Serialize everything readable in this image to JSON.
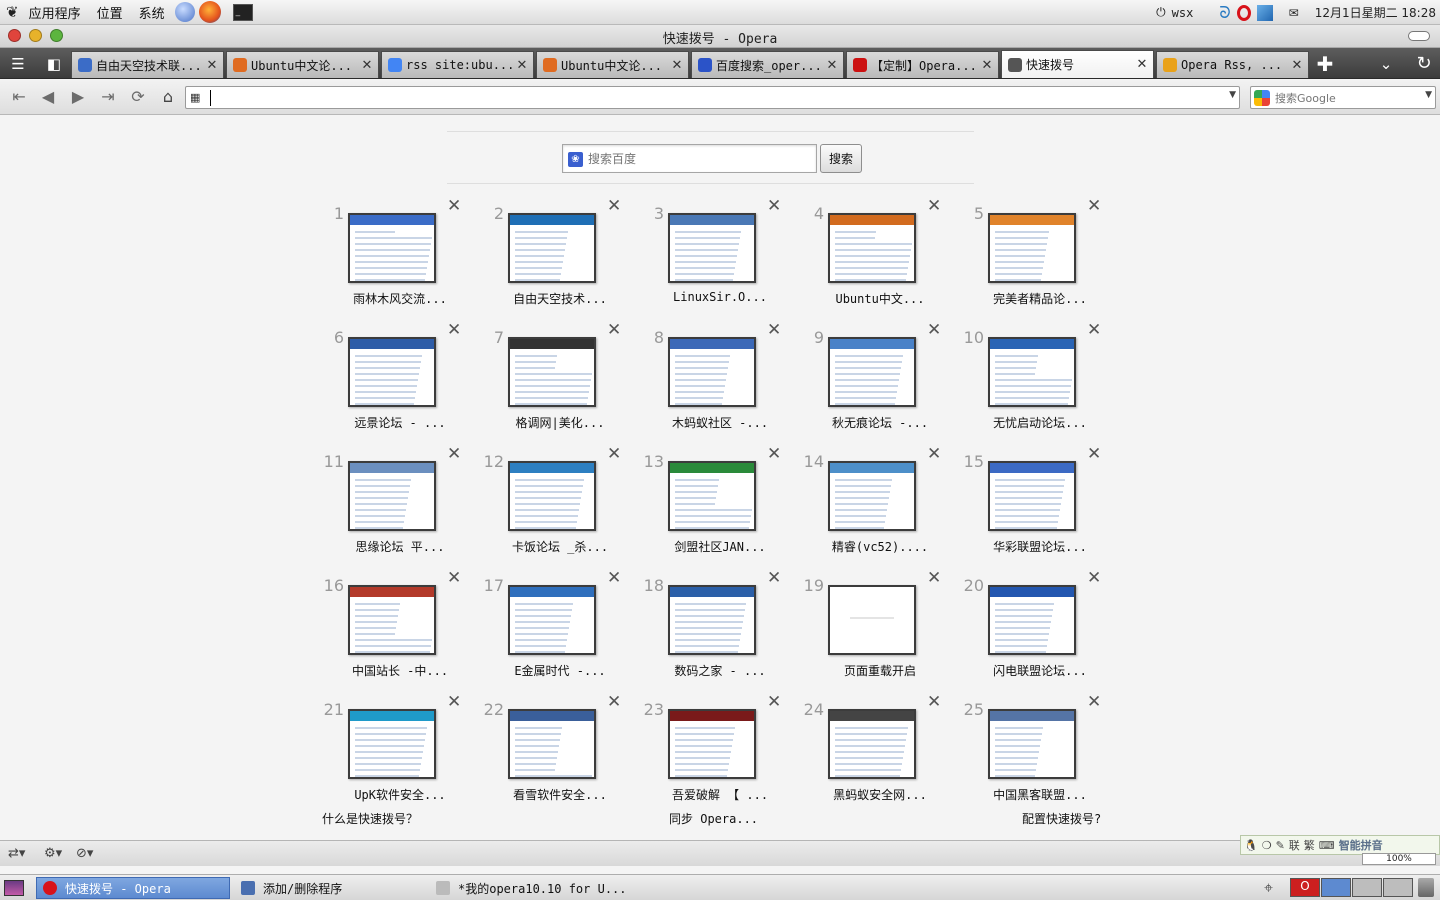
{
  "top_panel": {
    "menus": [
      "应用程序",
      "位置",
      "系统"
    ],
    "user": "wsx",
    "clock": "12月1日星期二 18:28"
  },
  "window": {
    "title": "快速拨号 - Opera"
  },
  "tabs": [
    {
      "label": "自由天空技术联...",
      "icon_color": "#3b6cc7"
    },
    {
      "label": "Ubuntu中文论...",
      "icon_color": "#e06b21"
    },
    {
      "label": "rss site:ubu...",
      "icon_color": "#4285f4"
    },
    {
      "label": "Ubuntu中文论...",
      "icon_color": "#e06b21"
    },
    {
      "label": "百度搜索_oper...",
      "icon_color": "#2b53c8"
    },
    {
      "label": "【定制】Opera...",
      "icon_color": "#cc1111"
    },
    {
      "label": "快速拨号",
      "icon_color": "#555555",
      "active": true
    },
    {
      "label": "Opera Rss, ...",
      "icon_color": "#e9a21a"
    }
  ],
  "navbar": {
    "address_value": "",
    "search_placeholder": "搜索Google"
  },
  "speed_dial": {
    "search_placeholder": "搜索百度",
    "search_button": "搜索",
    "cells": [
      {
        "n": "1",
        "caption": "雨林木风交流..."
      },
      {
        "n": "2",
        "caption": "自由天空技术..."
      },
      {
        "n": "3",
        "caption": "LinuxSir.O..."
      },
      {
        "n": "4",
        "caption": "Ubuntu中文..."
      },
      {
        "n": "5",
        "caption": "完美者精品论..."
      },
      {
        "n": "6",
        "caption": "远景论坛 - ..."
      },
      {
        "n": "7",
        "caption": "格调网|美化..."
      },
      {
        "n": "8",
        "caption": "木蚂蚁社区 -..."
      },
      {
        "n": "9",
        "caption": "秋无痕论坛 -..."
      },
      {
        "n": "10",
        "caption": "无忧启动论坛..."
      },
      {
        "n": "11",
        "caption": "思缘论坛 平..."
      },
      {
        "n": "12",
        "caption": "卡饭论坛 _杀..."
      },
      {
        "n": "13",
        "caption": "剑盟社区JAN..."
      },
      {
        "n": "14",
        "caption": "精睿(vc52)...."
      },
      {
        "n": "15",
        "caption": "华彩联盟论坛..."
      },
      {
        "n": "16",
        "caption": "中国站长 -中..."
      },
      {
        "n": "17",
        "caption": "E金属时代 -..."
      },
      {
        "n": "18",
        "caption": "数码之家 - ..."
      },
      {
        "n": "19",
        "caption": "页面重载开启"
      },
      {
        "n": "20",
        "caption": "闪电联盟论坛..."
      },
      {
        "n": "21",
        "caption": "UpK软件安全..."
      },
      {
        "n": "22",
        "caption": "看雪软件安全..."
      },
      {
        "n": "23",
        "caption": "吾爱破解 【 ..."
      },
      {
        "n": "24",
        "caption": "黑蚂蚁安全网..."
      },
      {
        "n": "25",
        "caption": "中国黑客联盟..."
      }
    ],
    "footer_left": "什么是快速拨号？",
    "footer_middle": "同步 Opera...",
    "footer_right": "配置快速拨号?"
  },
  "statusbar": {
    "ime_label": "智能拼音",
    "ime_items": [
      "联",
      "繁"
    ],
    "zoom": "100%"
  },
  "taskbar": {
    "items": [
      {
        "label": "快速拨号 - Opera",
        "active": true
      },
      {
        "label": "添加/删除程序"
      },
      {
        "label": "*我的opera10.10 for U..."
      }
    ]
  }
}
